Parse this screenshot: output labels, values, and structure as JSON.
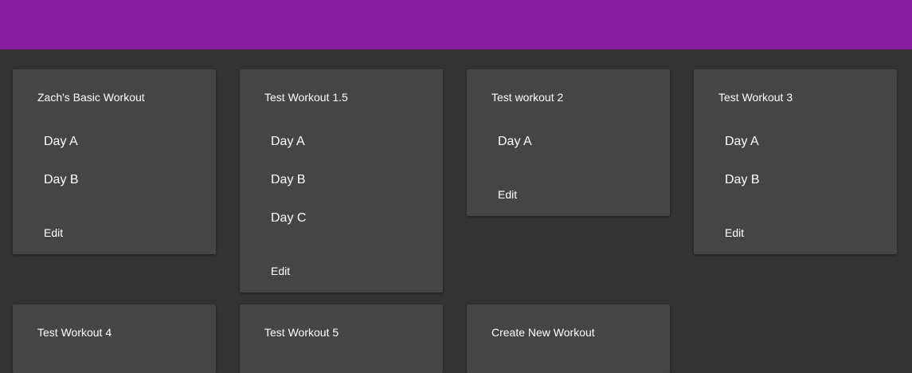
{
  "colors": {
    "app_bar": "#881ea0",
    "background": "#333333",
    "card": "#454545",
    "text": "#ffffff"
  },
  "workouts": [
    {
      "title": "Zach's Basic Workout",
      "days": [
        "Day A",
        "Day B"
      ],
      "edit_label": "Edit"
    },
    {
      "title": "Test Workout 1.5",
      "days": [
        "Day A",
        "Day B",
        "Day C"
      ],
      "edit_label": "Edit"
    },
    {
      "title": "Test workout 2",
      "days": [
        "Day A"
      ],
      "edit_label": "Edit"
    },
    {
      "title": "Test Workout 3",
      "days": [
        "Day A",
        "Day B"
      ],
      "edit_label": "Edit"
    },
    {
      "title": "Test Workout 4",
      "days": [],
      "edit_label": ""
    },
    {
      "title": "Test Workout 5",
      "days": [],
      "edit_label": ""
    }
  ],
  "create_card": {
    "title": "Create New Workout"
  }
}
